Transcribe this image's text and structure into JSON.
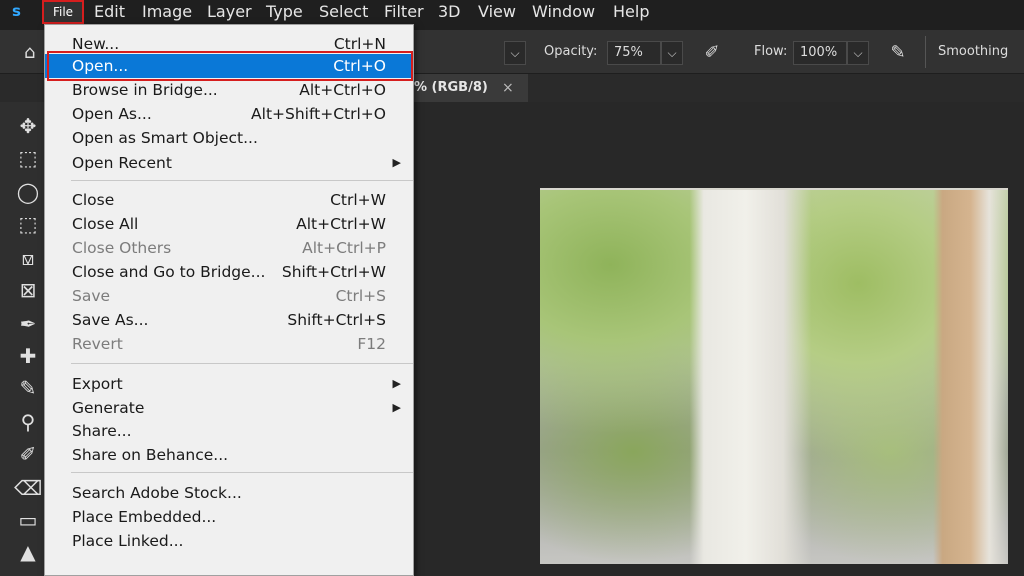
{
  "menubar": {
    "logo": "s",
    "items": [
      "File",
      "Edit",
      "Image",
      "Layer",
      "Type",
      "Select",
      "Filter",
      "3D",
      "View",
      "Window",
      "Help"
    ]
  },
  "options": {
    "opacity_label": "Opacity:",
    "opacity_value": "75%",
    "flow_label": "Flow:",
    "flow_value": "100%",
    "smoothing_label": "Smoothing"
  },
  "document_tab": {
    "label": "% (RGB/8)",
    "close": "×"
  },
  "file_menu": {
    "items": [
      {
        "label": "New...",
        "shortcut": "Ctrl+N"
      },
      {
        "label": "Open...",
        "shortcut": "Ctrl+O"
      },
      {
        "label": "Browse in Bridge...",
        "shortcut": "Alt+Ctrl+O"
      },
      {
        "label": "Open As...",
        "shortcut": "Alt+Shift+Ctrl+O"
      },
      {
        "label": "Open as Smart Object...",
        "shortcut": ""
      },
      {
        "label": "Open Recent",
        "shortcut": ""
      },
      {
        "label": "Close",
        "shortcut": "Ctrl+W"
      },
      {
        "label": "Close All",
        "shortcut": "Alt+Ctrl+W"
      },
      {
        "label": "Close Others",
        "shortcut": "Alt+Ctrl+P"
      },
      {
        "label": "Close and Go to Bridge...",
        "shortcut": "Shift+Ctrl+W"
      },
      {
        "label": "Save",
        "shortcut": "Ctrl+S"
      },
      {
        "label": "Save As...",
        "shortcut": "Shift+Ctrl+S"
      },
      {
        "label": "Revert",
        "shortcut": "F12"
      },
      {
        "label": "Export",
        "shortcut": ""
      },
      {
        "label": "Generate",
        "shortcut": ""
      },
      {
        "label": "Share...",
        "shortcut": ""
      },
      {
        "label": "Share on Behance...",
        "shortcut": ""
      },
      {
        "label": "Search Adobe Stock...",
        "shortcut": ""
      },
      {
        "label": "Place Embedded...",
        "shortcut": ""
      },
      {
        "label": "Place Linked...",
        "shortcut": ""
      }
    ],
    "submenu_arrow": "▶"
  },
  "icons": {
    "home": "⌂",
    "caret": "⌵",
    "airbrush": "✎",
    "pressure": "✐"
  },
  "tools": [
    "✥",
    "⬚",
    "◯",
    "⬚",
    "⟏",
    "⊠",
    "✒",
    "✚",
    "✎",
    "⚲",
    "✐",
    "⌫",
    "▭",
    "▲"
  ],
  "colors": {
    "accent_highlight": "#0a78d7",
    "annotation_red": "#d61e1e"
  }
}
